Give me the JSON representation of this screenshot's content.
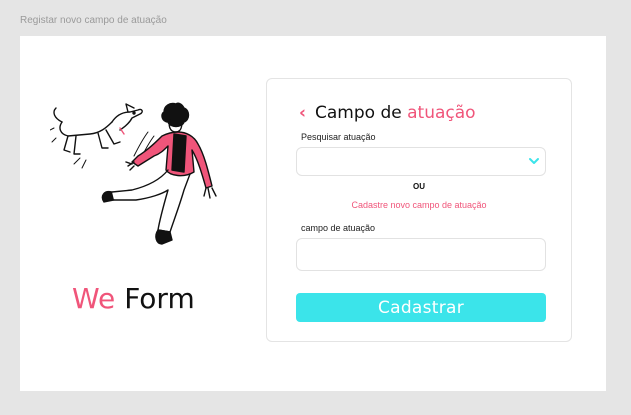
{
  "frame": {
    "label": "Registar novo campo de atuação"
  },
  "brand": {
    "word1": "We",
    "word2": "Form"
  },
  "form": {
    "back_icon": "chevron-left",
    "title_part1": "Campo de ",
    "title_part2": "atuação",
    "search_label": "Pesquisar atuação",
    "search_value": "",
    "or_text": "OU",
    "register_link": "Cadastre novo campo de atuação",
    "field_label": "campo de atuação",
    "field_value": "",
    "submit_label": "Cadastrar"
  },
  "colors": {
    "accent_pink": "#f0557a",
    "accent_cyan": "#3be4ea",
    "text_dark": "#111111"
  }
}
